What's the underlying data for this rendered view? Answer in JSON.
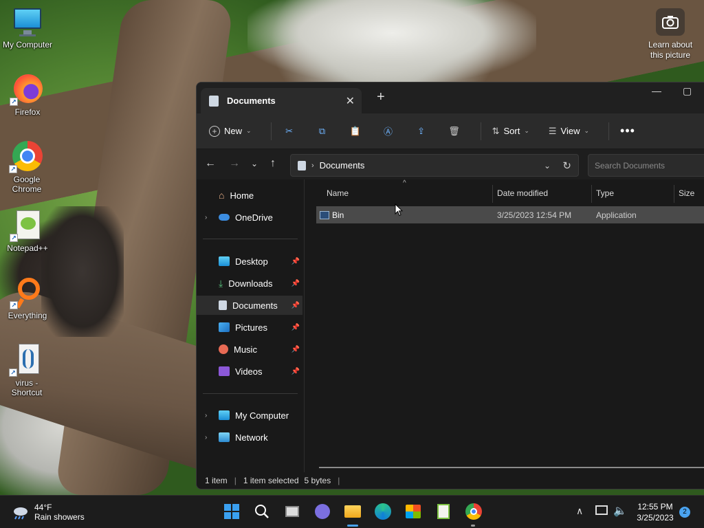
{
  "desktop": {
    "icons": [
      {
        "label": "My Computer"
      },
      {
        "label": "Firefox"
      },
      {
        "label": "Google Chrome"
      },
      {
        "label": "Notepad++"
      },
      {
        "label": "Everything"
      },
      {
        "label": "virus - Shortcut"
      }
    ],
    "learn_about": "Learn about this picture"
  },
  "explorer": {
    "tab_title": "Documents",
    "toolbar": {
      "new_label": "New",
      "sort_label": "Sort",
      "view_label": "View"
    },
    "address": {
      "path": "Documents",
      "search_placeholder": "Search Documents"
    },
    "sidebar": {
      "items": [
        {
          "label": "Home"
        },
        {
          "label": "OneDrive"
        },
        {
          "label": "Desktop"
        },
        {
          "label": "Downloads"
        },
        {
          "label": "Documents"
        },
        {
          "label": "Pictures"
        },
        {
          "label": "Music"
        },
        {
          "label": "Videos"
        },
        {
          "label": "My Computer"
        },
        {
          "label": "Network"
        }
      ]
    },
    "columns": {
      "name": "Name",
      "date_modified": "Date modified",
      "type": "Type",
      "size": "Size"
    },
    "files": [
      {
        "name": "Bin",
        "date_modified": "3/25/2023 12:54 PM",
        "type": "Application"
      }
    ],
    "status": {
      "count": "1 item",
      "selected": "1 item selected",
      "size": "5 bytes"
    }
  },
  "taskbar": {
    "weather_temp": "44°F",
    "weather_desc": "Rain showers",
    "time": "12:55 PM",
    "date": "3/25/2023",
    "notification_count": "2"
  },
  "colors": {
    "accent": "#4aa3f0",
    "selection_row": "#4a4a4a",
    "window_bg": "#191919"
  }
}
